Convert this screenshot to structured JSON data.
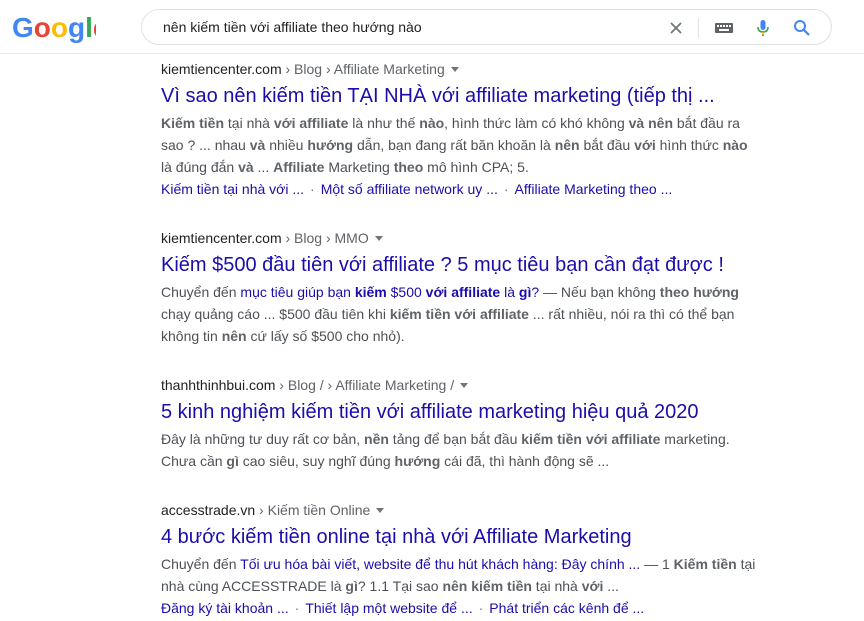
{
  "header": {
    "logo_text": "Google",
    "search_query": "nên kiếm tiền với affiliate theo hướng nào",
    "icons": [
      "clear-icon",
      "keyboard-icon",
      "mic-icon",
      "search-icon"
    ]
  },
  "colors": {
    "link": "#1a0dab",
    "text": "#4d5156",
    "bold": "#5f6368",
    "crumb": "#202124",
    "accent_blue": "#4285f4"
  },
  "results": [
    {
      "domain": "kiemtiencenter.com",
      "path": " › Blog › Affiliate Marketing",
      "title": "Vì sao nên kiếm tiền TẠI NHÀ với affiliate marketing (tiếp thị ...",
      "lines": [
        [
          {
            "b": "Kiếm tiền"
          },
          {
            "t": " tại nhà "
          },
          {
            "b": "với affiliate"
          },
          {
            "t": " là như thế "
          },
          {
            "b": "nào"
          },
          {
            "t": ", hình thức làm có khó không "
          },
          {
            "b": "và nên"
          },
          {
            "t": " bắt đầu ra"
          }
        ],
        [
          {
            "t": "sao ? ... nhau "
          },
          {
            "b": "và"
          },
          {
            "t": " nhiều "
          },
          {
            "b": "hướng"
          },
          {
            "t": " dẫn, bạn đang rất băn khoăn là "
          },
          {
            "b": "nên"
          },
          {
            "t": " bắt đầu "
          },
          {
            "b": "với"
          },
          {
            "t": " hình thức "
          },
          {
            "b": "nào"
          }
        ],
        [
          {
            "t": "là đúng đắn "
          },
          {
            "b": "và"
          },
          {
            "t": " ... "
          },
          {
            "b": "Affiliate"
          },
          {
            "t": " Marketing "
          },
          {
            "b": "theo"
          },
          {
            "t": " mô hình CPA; 5."
          }
        ]
      ],
      "sublinks": [
        "Kiếm tiền tại nhà với ...",
        "Một số affiliate network uy ...",
        "Affiliate Marketing theo ..."
      ]
    },
    {
      "domain": "kiemtiencenter.com",
      "path": " › Blog › MMO",
      "title": "Kiếm $500 đầu tiên với affiliate ? 5 mục tiêu bạn cần đạt được !",
      "lines": [
        [
          {
            "t": "Chuyển đến "
          },
          {
            "l": "mục tiêu giúp bạn "
          },
          {
            "lb": "kiếm"
          },
          {
            "l": " $500 "
          },
          {
            "lb": "với affiliate"
          },
          {
            "l": " là "
          },
          {
            "lb": "gì"
          },
          {
            "l": "?"
          },
          {
            "t": " — Nếu bạn không "
          },
          {
            "b": "theo hướng"
          }
        ],
        [
          {
            "t": "chạy quảng cáo ... $500 đầu tiên khi "
          },
          {
            "b": "kiếm tiền với affiliate"
          },
          {
            "t": " ... rất nhiều, nói ra thì có thể bạn"
          }
        ],
        [
          {
            "t": "không tin "
          },
          {
            "b": "nên"
          },
          {
            "t": " cứ lấy số $500 cho nhỏ)."
          }
        ]
      ],
      "sublinks": []
    },
    {
      "domain": "thanhthinhbui.com",
      "path": " › Blog / › Affiliate Marketing /",
      "title": "5 kinh nghiệm kiếm tiền với affiliate marketing hiệu quả 2020",
      "lines": [
        [
          {
            "t": "Đây là những tư duy rất cơ bản, "
          },
          {
            "b": "nền"
          },
          {
            "t": " tảng để bạn bắt đầu "
          },
          {
            "b": "kiếm tiền với affiliate"
          },
          {
            "t": " marketing."
          }
        ],
        [
          {
            "t": "Chưa cần "
          },
          {
            "b": "gì"
          },
          {
            "t": " cao siêu, suy nghĩ đúng "
          },
          {
            "b": "hướng"
          },
          {
            "t": " cái đã, thì hành động sẽ ..."
          }
        ]
      ],
      "sublinks": []
    },
    {
      "domain": "accesstrade.vn",
      "path": " › Kiếm tiền Online",
      "title": "4 bước kiếm tiền online tại nhà với Affiliate Marketing",
      "lines": [
        [
          {
            "t": "Chuyển đến "
          },
          {
            "l": "Tối ưu hóa bài viết, website để thu hút khách hàng: Đây chính ..."
          },
          {
            "t": " — 1 "
          },
          {
            "b": "Kiếm tiền"
          },
          {
            "t": " tại"
          }
        ],
        [
          {
            "t": "nhà cùng ACCESSTRADE là "
          },
          {
            "b": "gì"
          },
          {
            "t": "? 1.1 Tại sao "
          },
          {
            "b": "nên kiếm tiền"
          },
          {
            "t": " tại nhà "
          },
          {
            "b": "với"
          },
          {
            "t": " ..."
          }
        ]
      ],
      "sublinks": [
        "Đăng ký tài khoản ...",
        "Thiết lập một website để ...",
        "Phát triển các kênh để ..."
      ]
    }
  ]
}
